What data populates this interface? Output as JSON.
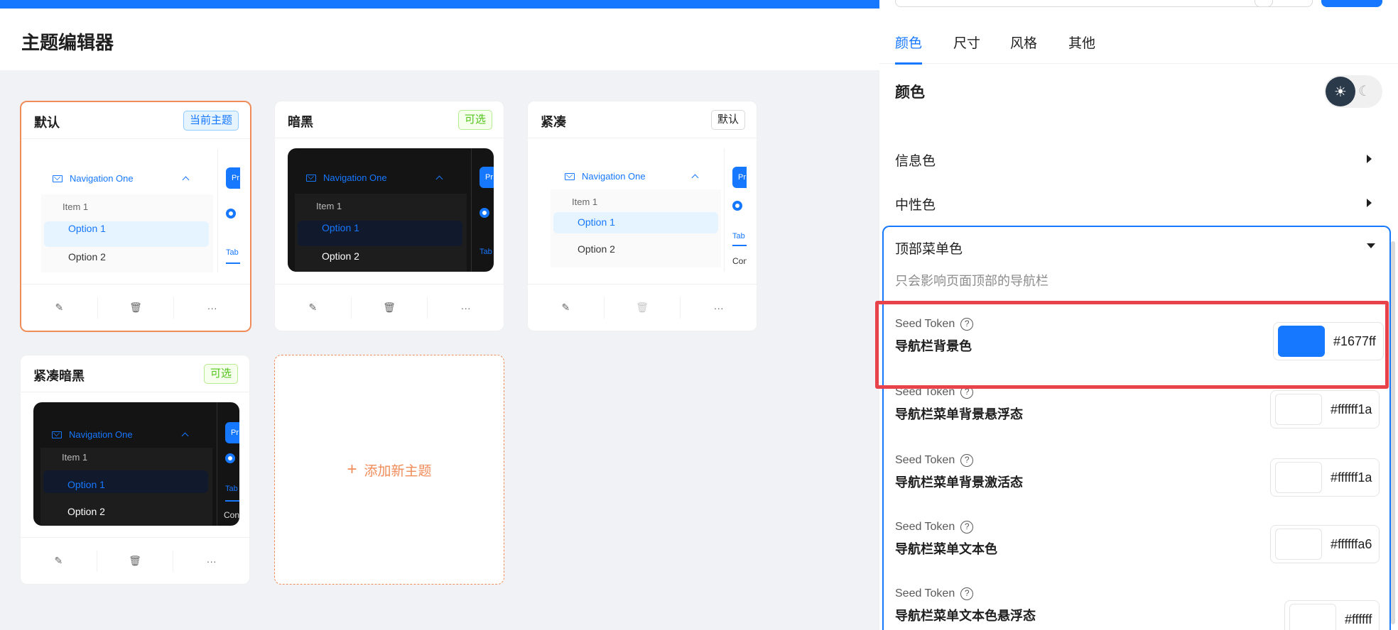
{
  "page": {
    "title": "主题编辑器"
  },
  "themes": [
    {
      "name": "默认",
      "badge": "当前主题",
      "style": "light",
      "menu_nav": "Navigation One",
      "item": "Item 1",
      "option1": "Option 1",
      "option2": "Option 2"
    },
    {
      "name": "暗黑",
      "badge": "可选",
      "style": "dark",
      "menu_nav": "Navigation One",
      "item": "Item 1",
      "option1": "Option 1",
      "option2": "Option 2"
    },
    {
      "name": "紧凑",
      "badge": "默认",
      "style": "light",
      "menu_nav": "Navigation One",
      "item": "Item 1",
      "option1": "Option 1",
      "option2": "Option 2"
    },
    {
      "name": "紧凑暗黑",
      "badge": "可选",
      "style": "dark",
      "menu_nav": "Navigation One",
      "item": "Item 1",
      "option1": "Option 1",
      "option2": "Option 2"
    }
  ],
  "preview_side": {
    "button": "Pr",
    "tab": "Tab",
    "content": "Con"
  },
  "add_card": {
    "label": "添加新主题"
  },
  "panel": {
    "tabs": [
      "颜色",
      "尺寸",
      "风格",
      "其他"
    ],
    "active_tab": "颜色",
    "section_title": "颜色",
    "mode": {
      "light_icon": "☀",
      "dark_icon": "☾"
    },
    "collapsed": [
      {
        "label": "信息色"
      },
      {
        "label": "中性色"
      }
    ],
    "open_group": {
      "title": "顶部菜单色",
      "description": "只会影响页面顶部的导航栏",
      "tokens": [
        {
          "seed": "Seed Token",
          "name": "导航栏背景色",
          "hex": "#1677ff",
          "swatch": "#1677ff"
        },
        {
          "seed": "Seed Token",
          "name": "导航栏菜单背景悬浮态",
          "hex": "#ffffff1a",
          "swatch": "#ffffff"
        },
        {
          "seed": "Seed Token",
          "name": "导航栏菜单背景激活态",
          "hex": "#ffffff1a",
          "swatch": "#ffffff"
        },
        {
          "seed": "Seed Token",
          "name": "导航栏菜单文本色",
          "hex": "#ffffffa6",
          "swatch": "#ffffff"
        },
        {
          "seed": "Seed Token",
          "name": "导航栏菜单文本色悬浮态",
          "hex": "#ffffff",
          "swatch": "#ffffff"
        }
      ]
    }
  },
  "colors": {
    "primary": "#1677ff",
    "accent_orange": "#f08c5a",
    "highlight_red": "#e8424a"
  }
}
